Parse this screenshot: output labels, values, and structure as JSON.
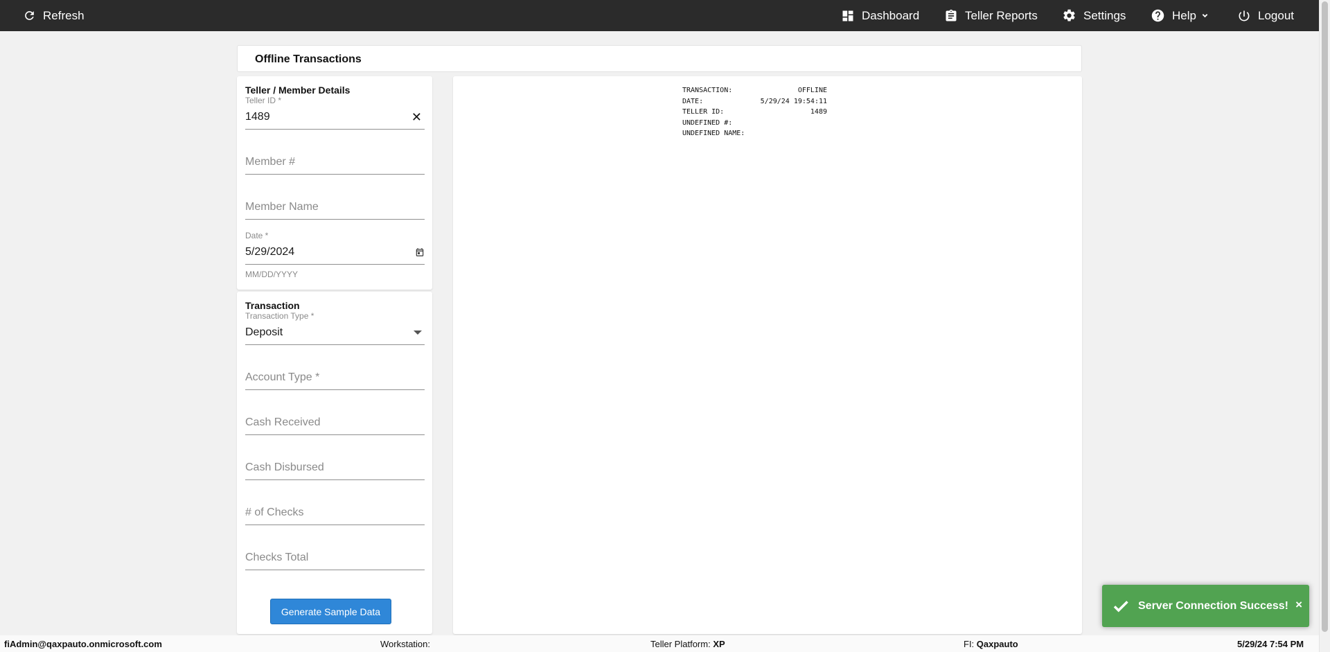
{
  "nav": {
    "refresh": {
      "label": "Refresh",
      "icon": "refresh-icon"
    },
    "dashboard": {
      "label": "Dashboard",
      "icon": "dashboard-icon"
    },
    "teller_reports": {
      "label": "Teller Reports",
      "icon": "clipboard-icon"
    },
    "settings": {
      "label": "Settings",
      "icon": "gear-icon"
    },
    "help": {
      "label": "Help",
      "icon": "help-circle-icon"
    },
    "logout": {
      "label": "Logout",
      "icon": "power-icon"
    }
  },
  "page": {
    "title": "Offline Transactions"
  },
  "member_details": {
    "title": "Teller / Member Details",
    "teller_id": {
      "label": "Teller ID *",
      "value": "1489"
    },
    "member_number": {
      "placeholder": "Member #"
    },
    "member_name": {
      "placeholder": "Member Name"
    },
    "date": {
      "label": "Date *",
      "value": "5/29/2024",
      "hint": "MM/DD/YYYY"
    }
  },
  "transaction": {
    "title": "Transaction",
    "transaction_type": {
      "label": "Transaction Type *",
      "value": "Deposit"
    },
    "account_type": {
      "placeholder": "Account Type *"
    },
    "cash_received": {
      "placeholder": "Cash Received"
    },
    "cash_disbursed": {
      "placeholder": "Cash Disbursed"
    },
    "num_checks": {
      "placeholder": "# of Checks"
    },
    "checks_total": {
      "placeholder": "Checks Total"
    },
    "generate_button": "Generate Sample Data"
  },
  "receipt": {
    "lines": [
      {
        "label": "TRANSACTION:",
        "value": "OFFLINE"
      },
      {
        "label": "DATE:",
        "value": "5/29/24 19:54:11"
      },
      {
        "label": "TELLER ID:",
        "value": "1489"
      },
      {
        "label": "UNDEFINED #:",
        "value": ""
      },
      {
        "label": "UNDEFINED NAME:",
        "value": ""
      }
    ]
  },
  "footer": {
    "user": "fiAdmin@qaxpauto.onmicrosoft.com",
    "workstation_label": "Workstation:",
    "workstation_value": "",
    "platform_label": "Teller Platform:",
    "platform_value": "XP",
    "fi_label": "FI:",
    "fi_value": "Qaxpauto",
    "datetime": "5/29/24 7:54 PM"
  },
  "toast": {
    "message": "Server Connection Success!",
    "close": "×",
    "color": "#51a351"
  },
  "colors": {
    "topbar": "#2b2b2b",
    "primary_button": "#2f87d8",
    "background": "#f1f1f1"
  }
}
